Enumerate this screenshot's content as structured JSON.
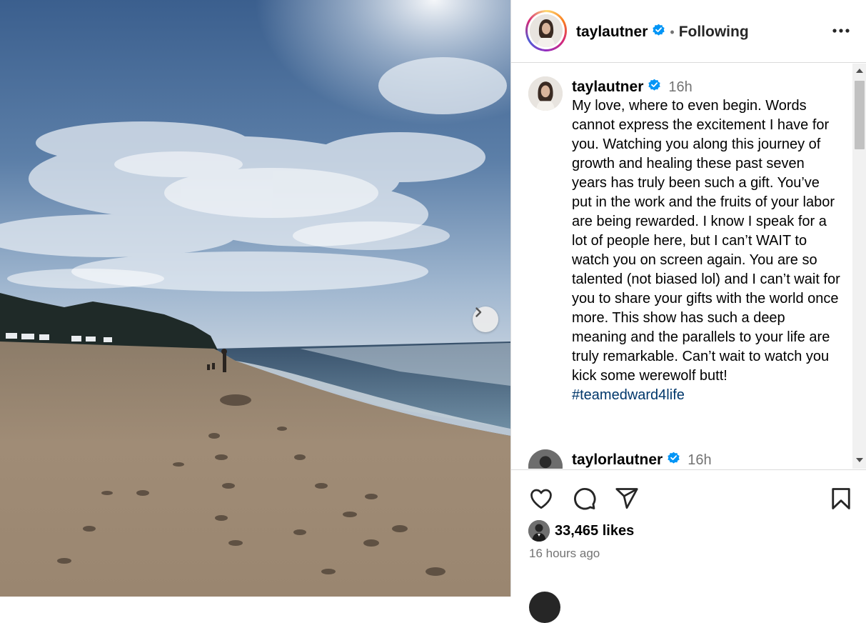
{
  "photo": {
    "description_icon": "chevron-right-icon"
  },
  "header": {
    "username": "taylautner",
    "separator": "•",
    "follow_status": "Following",
    "more_icon": "more-horizontal-icon"
  },
  "caption": {
    "username": "taylautner",
    "time": "16h",
    "text": "My love, where to even begin. Words cannot express the excitement I have for you. Watching you along this journey of growth and healing these past seven years has truly been such a gift. You’ve put in the work and the fruits of your labor are being rewarded. I know I speak for a lot of people here, but I can’t WAIT to watch you on screen again. You are so talented (not biased lol) and I can’t wait for you to share your gifts with the world once more. This show has such a deep meaning and the parallels to your life are truly remarkable. Can’t wait to watch you kick some werewolf butt!",
    "hashtag": "#teamedward4life"
  },
  "comment": {
    "username": "taylorlautner",
    "time": "16h"
  },
  "actions": {
    "like_icon": "heart-icon",
    "comment_icon": "comment-icon",
    "share_icon": "send-icon",
    "save_icon": "bookmark-icon"
  },
  "stats": {
    "likes": "33,465 likes",
    "posted": "16 hours ago"
  },
  "colors": {
    "verified": "#0095f6",
    "hashtag": "#00376b",
    "muted": "#737373"
  }
}
